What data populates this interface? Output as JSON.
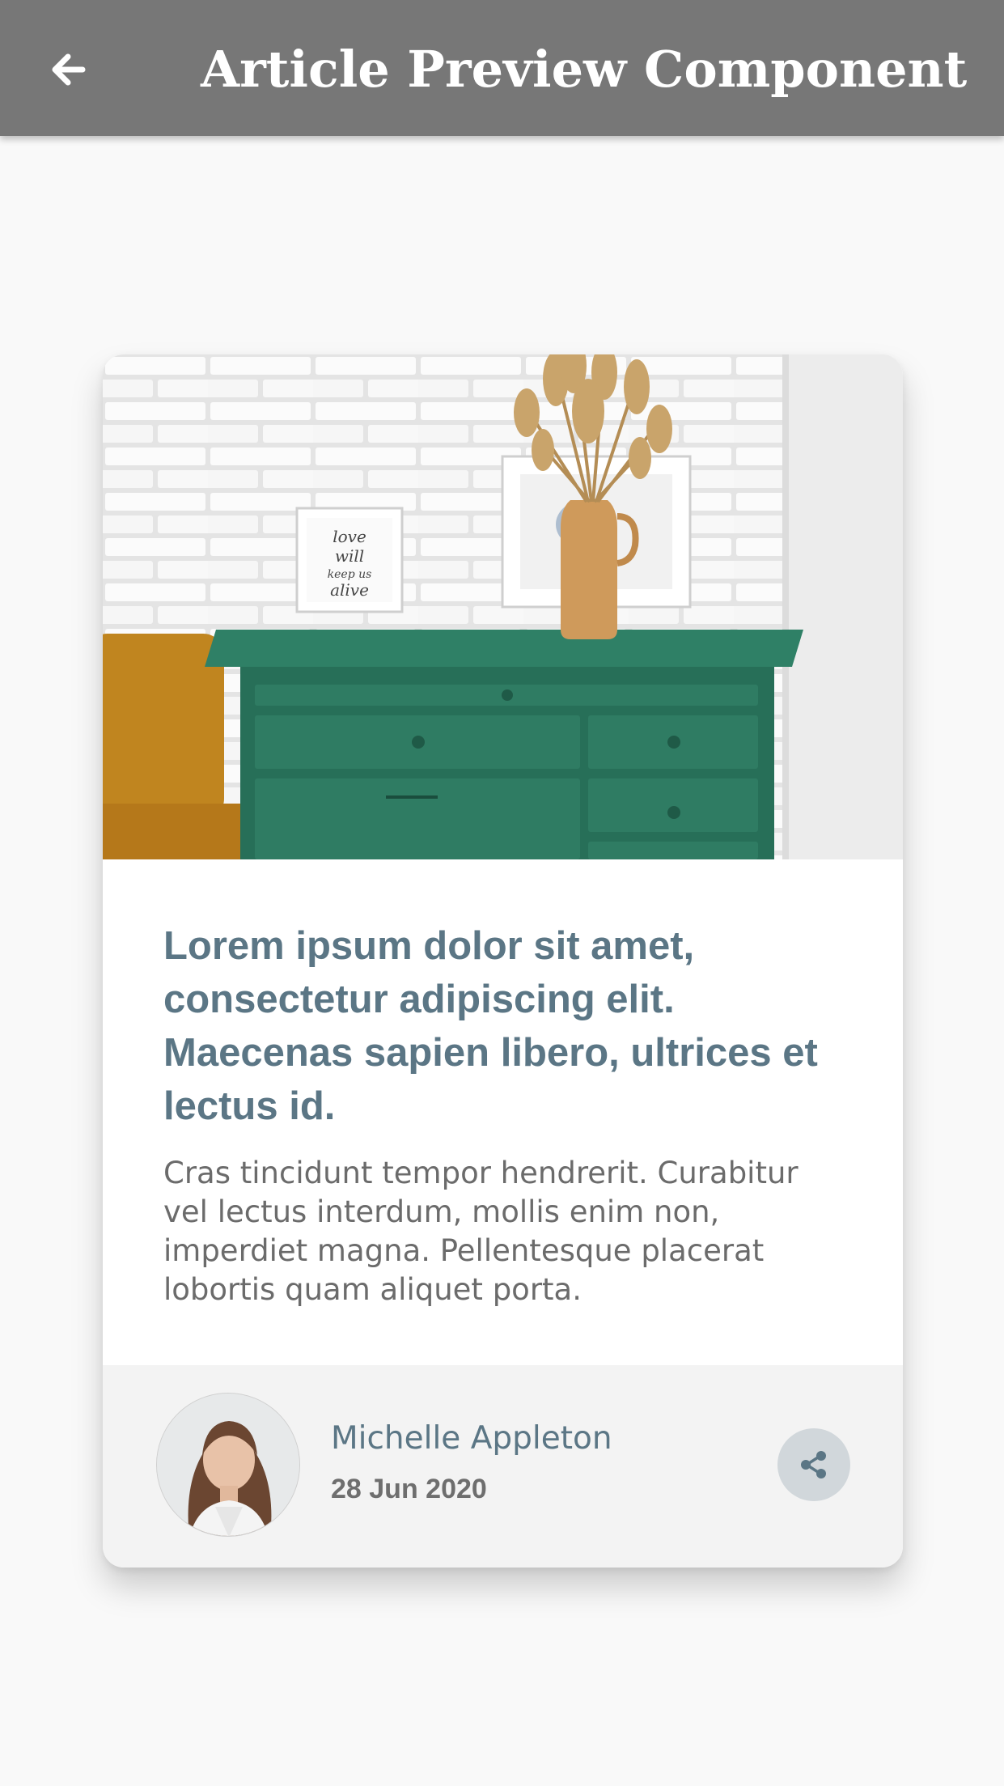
{
  "appbar": {
    "title": "Article Preview Component",
    "back_icon": "arrow-left-icon"
  },
  "article": {
    "image_alt": "Green drawers with a vase of dried grass and framed prints in front of a white brick wall",
    "image_print_text": "love will keep us alive",
    "headline": "Lorem ipsum dolor sit amet, consectetur adipiscing elit. Maecenas sapien libero, ultrices et lectus id.",
    "excerpt": "Cras tincidunt tempor hendrerit. Curabitur vel lectus interdum, mollis enim non, imperdiet magna. Pellentesque placerat lobortis quam aliquet porta."
  },
  "author": {
    "name": "Michelle Appleton",
    "date": "28 Jun 2020"
  },
  "actions": {
    "share_icon": "share-icon"
  },
  "colors": {
    "appbar": "#777777",
    "heading": "#5b7685",
    "body_text": "#6b6b6b",
    "footer_bg": "#f3f3f3",
    "share_bg": "#d1d7db",
    "drawer_green": "#2e7a62"
  }
}
